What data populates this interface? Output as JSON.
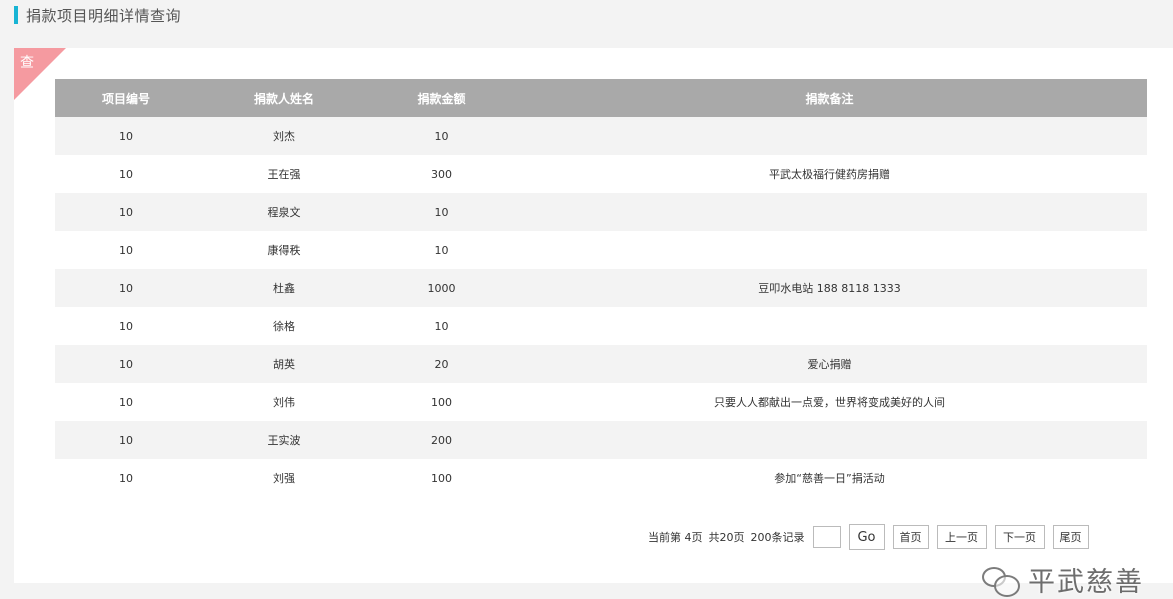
{
  "page": {
    "title": "捐款项目明细详情查询"
  },
  "panel": {
    "corner_label": "查"
  },
  "table": {
    "headers": [
      "项目编号",
      "捐款人姓名",
      "捐款金额",
      "捐款备注"
    ],
    "rows": [
      {
        "project_id": "10",
        "name": "刘杰",
        "amount": "10",
        "note": ""
      },
      {
        "project_id": "10",
        "name": "王在强",
        "amount": "300",
        "note": "平武太极福行健药房捐赠"
      },
      {
        "project_id": "10",
        "name": "程泉文",
        "amount": "10",
        "note": ""
      },
      {
        "project_id": "10",
        "name": "康得秩",
        "amount": "10",
        "note": ""
      },
      {
        "project_id": "10",
        "name": "杜鑫",
        "amount": "1000",
        "note": "豆叩水电站  188  8118  1333"
      },
      {
        "project_id": "10",
        "name": "徐格",
        "amount": "10",
        "note": ""
      },
      {
        "project_id": "10",
        "name": "胡英",
        "amount": "20",
        "note": "爱心捐赠"
      },
      {
        "project_id": "10",
        "name": "刘伟",
        "amount": "100",
        "note": "只要人人都献出一点爱，世界将变成美好的人间"
      },
      {
        "project_id": "10",
        "name": "王实波",
        "amount": "200",
        "note": ""
      },
      {
        "project_id": "10",
        "name": "刘强",
        "amount": "100",
        "note": "参加“慈善一日”捐活动"
      }
    ]
  },
  "pager": {
    "current_page": "当前第  4页",
    "total_pages": "共20页",
    "total_records": "200条记录",
    "page_input_value": "",
    "go_label": "Go",
    "first_label": "首页",
    "prev_label": "上一页",
    "next_label": "下一页",
    "last_label": "尾页"
  },
  "watermark": {
    "text": "平武慈善",
    "icon": "wechat-icon"
  },
  "colors": {
    "accent": "#18b4d4",
    "corner": "#f59aa0",
    "header_bg": "#a9a9a9",
    "stripe": "#f3f3f3"
  }
}
